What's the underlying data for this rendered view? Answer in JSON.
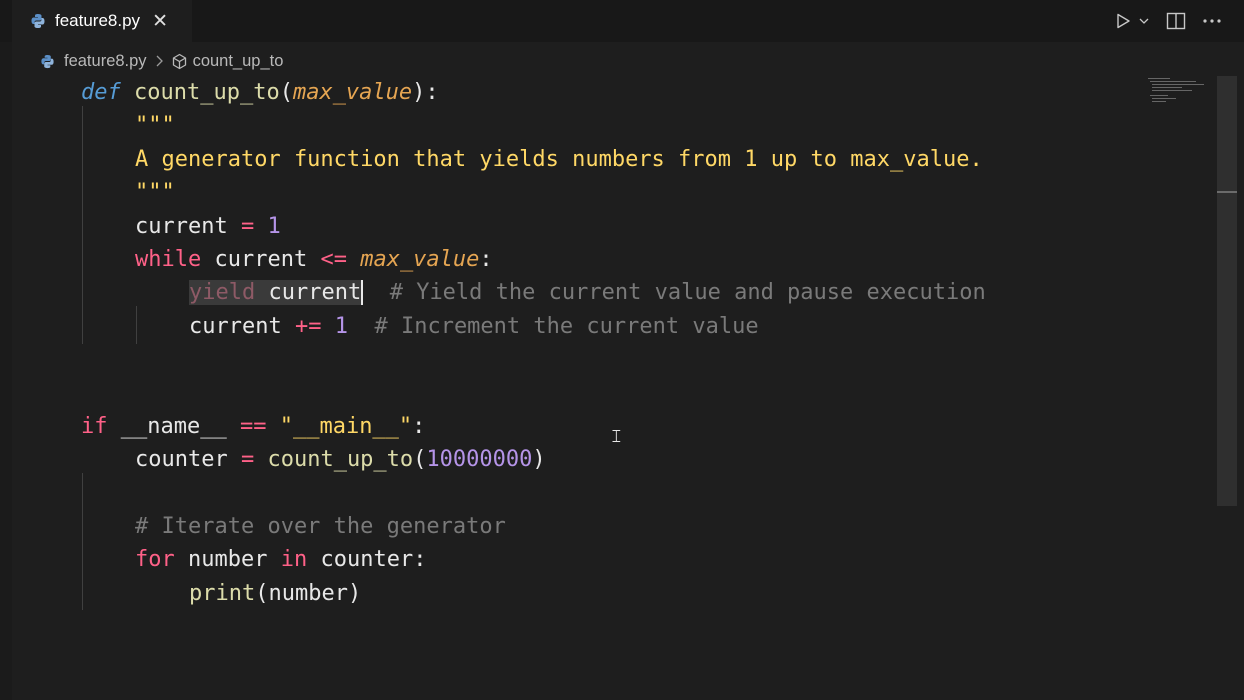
{
  "tab": {
    "filename": "feature8.py"
  },
  "breadcrumb": {
    "file": "feature8.py",
    "symbol": "count_up_to"
  },
  "code": {
    "l1": {
      "def": "def",
      "fn": "count_up_to",
      "open": "(",
      "param": "max_value",
      "close": "):"
    },
    "l2": {
      "docq": "\"\"\""
    },
    "l3": {
      "doc": "A generator function that yields numbers from 1 up to max_value."
    },
    "l4": {
      "docq": "\"\"\""
    },
    "l5": {
      "var": "current",
      "op": "=",
      "num": "1"
    },
    "l6": {
      "kw": "while",
      "var": "current",
      "op": "<=",
      "param": "max_value",
      "colon": ":"
    },
    "l7": {
      "kw": "yield",
      "var": "current",
      "comment": "# Yield the current value and pause execution"
    },
    "l8": {
      "var": "current",
      "op": "+=",
      "num": "1",
      "comment": "# Increment the current value"
    },
    "l9": {
      "kw": "if",
      "name": "__name__",
      "op": "==",
      "str": "\"__main__\"",
      "colon": ":"
    },
    "l10": {
      "var": "counter",
      "op": "=",
      "fn": "count_up_to",
      "open": "(",
      "num": "10000000",
      "close": ")"
    },
    "l11": {
      "comment": "# Iterate over the generator"
    },
    "l12": {
      "kw": "for",
      "var": "number",
      "kw2": "in",
      "iter": "counter",
      "colon": ":"
    },
    "l13": {
      "fn": "print",
      "open": "(",
      "arg": "number",
      "close": ")"
    }
  },
  "icons": [
    "python-file-icon",
    "close-icon",
    "chevron-right-icon",
    "symbol-method-icon",
    "run-icon",
    "chevron-down-icon",
    "split-editor-icon",
    "more-actions-icon",
    "text-cursor-icon"
  ]
}
